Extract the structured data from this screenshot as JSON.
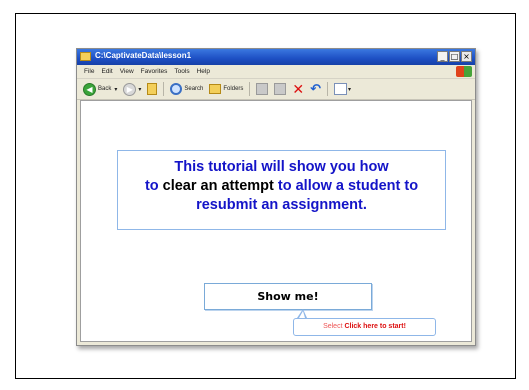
{
  "window": {
    "title": "C:\\CaptivateData\\lesson1",
    "controls": {
      "minimize": "_",
      "maximize": "□",
      "close": "×"
    }
  },
  "menu": [
    "File",
    "Edit",
    "View",
    "Favorites",
    "Tools",
    "Help"
  ],
  "toolbar": {
    "back_label": "Back",
    "search_label": "Search",
    "folders_label": "Folders",
    "icons": [
      "back-icon",
      "forward-icon",
      "up-icon",
      "search-icon",
      "folders-icon",
      "move-to-icon",
      "copy-to-icon",
      "delete-icon",
      "undo-icon",
      "views-icon"
    ]
  },
  "caption": {
    "line1": "This tutorial will show you how",
    "line2_a": "to",
    "line2_b": " clear an attempt ",
    "line2_c": "to allow a student to",
    "line3": "resubmit an assignment."
  },
  "button": {
    "label": "Show me!"
  },
  "tooltip": {
    "prefix": "Select ",
    "cta": "Click here to start!"
  },
  "colors": {
    "caption_blue": "#1414c8",
    "titlebar": "#1d4fc4",
    "border_blue": "#8fb7e8",
    "tooltip_red": "#d11111"
  }
}
